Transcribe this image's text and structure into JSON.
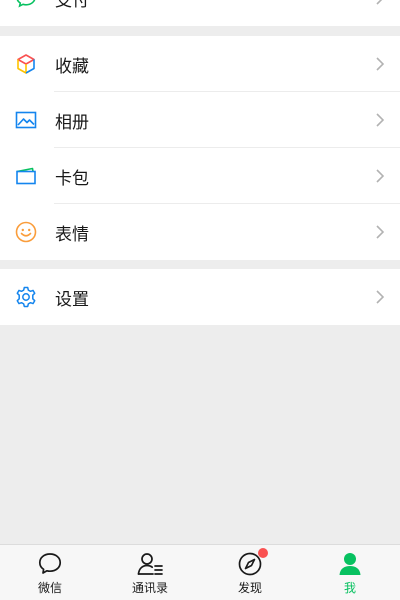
{
  "menu": {
    "pay": {
      "label": "支付",
      "icon": "wechat-pay-icon"
    },
    "group2": [
      {
        "label": "收藏",
        "icon": "favorites-cube-icon"
      },
      {
        "label": "相册",
        "icon": "album-image-icon"
      },
      {
        "label": "卡包",
        "icon": "card-wallet-icon"
      },
      {
        "label": "表情",
        "icon": "smiley-face-icon"
      }
    ],
    "settings": {
      "label": "设置",
      "icon": "gear-icon"
    }
  },
  "tabbar": {
    "tabs": [
      {
        "label": "微信",
        "icon": "chat-bubble-icon",
        "active": false
      },
      {
        "label": "通讯录",
        "icon": "contacts-icon",
        "active": false
      },
      {
        "label": "发现",
        "icon": "compass-icon",
        "active": false,
        "badge": true
      },
      {
        "label": "我",
        "icon": "person-icon",
        "active": true
      }
    ]
  },
  "colors": {
    "accent": "#07c160",
    "badge": "#fa5151",
    "background": "#ededed",
    "text": "#191919",
    "blue_icon": "#1485ee",
    "orange_icon": "#fa9d3b"
  }
}
